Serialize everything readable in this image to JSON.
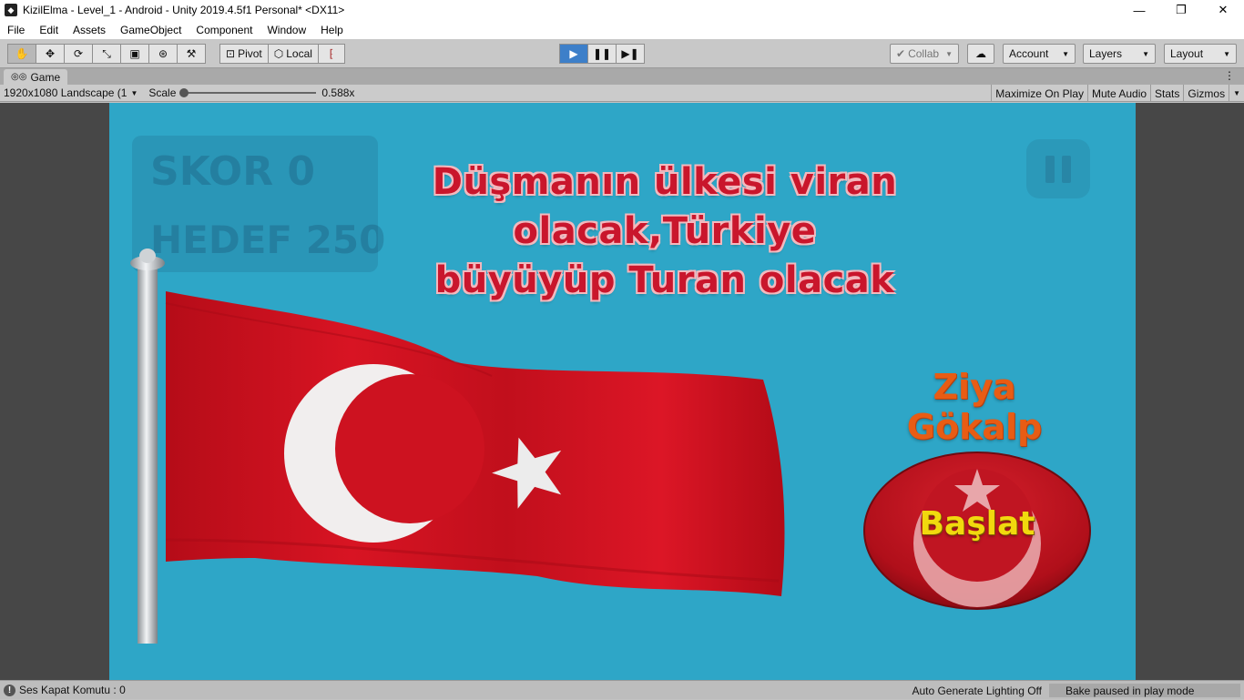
{
  "window": {
    "title": "KizilElma - Level_1 - Android - Unity 2019.4.5f1 Personal* <DX11>",
    "minimize": "—",
    "maximize": "❐",
    "close": "✕"
  },
  "menu": [
    "File",
    "Edit",
    "Assets",
    "GameObject",
    "Component",
    "Window",
    "Help"
  ],
  "toolbar": {
    "pivot_label": "Pivot",
    "local_label": "Local",
    "collab_label": "Collab",
    "account_label": "Account",
    "layers_label": "Layers",
    "layout_label": "Layout"
  },
  "game_tab": {
    "label": "Game",
    "resolution": "1920x1080 Landscape (1",
    "scale_label": "Scale",
    "scale_value": 0.588,
    "scale_text": "0.588x",
    "maximize_on_play": "Maximize On Play",
    "mute_audio": "Mute Audio",
    "stats": "Stats",
    "gizmos": "Gizmos"
  },
  "game": {
    "ghost_score": "SKOR 0",
    "ghost_target": "HEDEF 250",
    "quote_line1": "Düşmanın ülkesi viran olacak,Türkiye",
    "quote_line2": "büyüyüp Turan olacak",
    "author": "Ziya Gökalp",
    "start_button": "Başlat",
    "colors": {
      "background": "#2ea6c7",
      "flag_red": "#d0101e",
      "quote_red": "#c9162c",
      "author_orange": "#e85c14",
      "button_label_yellow": "#f1d90e"
    }
  },
  "status": {
    "message": "Ses Kapat Komutu : 0",
    "lighting": "Auto Generate Lighting Off",
    "bake": "Bake paused in play mode"
  }
}
